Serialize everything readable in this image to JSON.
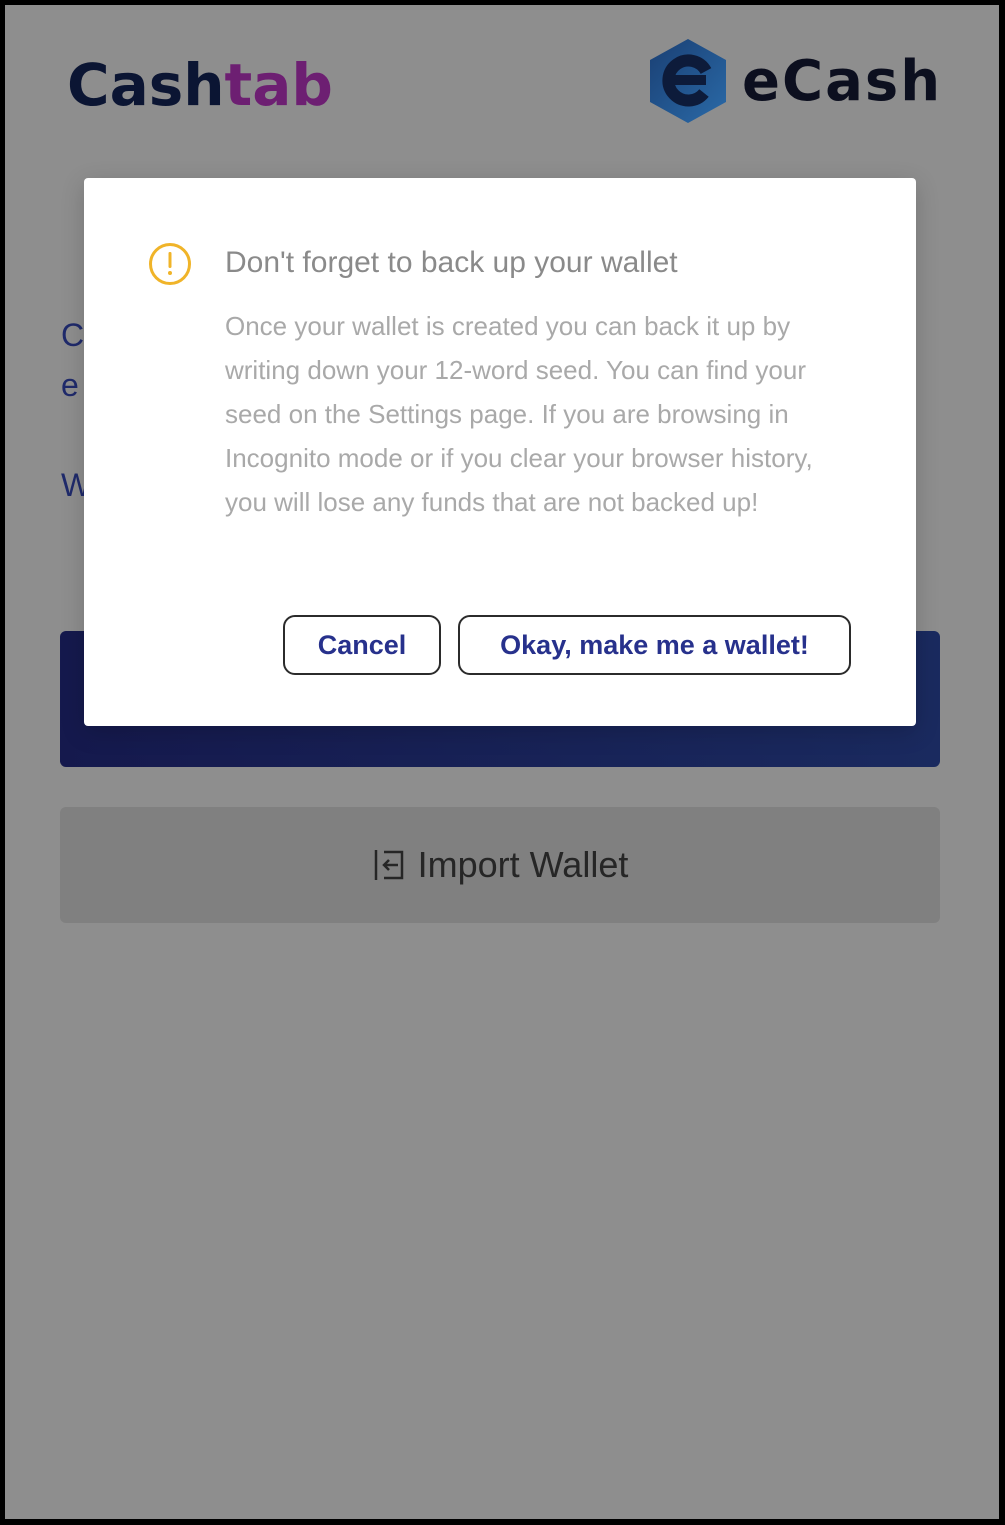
{
  "header": {
    "brand_part1": "Cash",
    "brand_part2": "tab",
    "ecash_label": "eCash",
    "colors": {
      "cash": "#0b1533",
      "tab": "#6d1f72"
    }
  },
  "background": {
    "line1_fragment": "C",
    "line2_fragment": "e",
    "line3_fragment": "W",
    "import_button_label": "Import Wallet"
  },
  "modal": {
    "icon": "exclamation-circle-icon",
    "title": "Don't forget to back up your wallet",
    "body": "Once your wallet is created you can back it up by writing down your 12-word seed. You can find your seed on the Settings page. If you are browsing in Incognito mode or if you clear your browser history, you will lose any funds that are not backed up!",
    "cancel_label": "Cancel",
    "confirm_label": "Okay, make me a wallet!"
  }
}
